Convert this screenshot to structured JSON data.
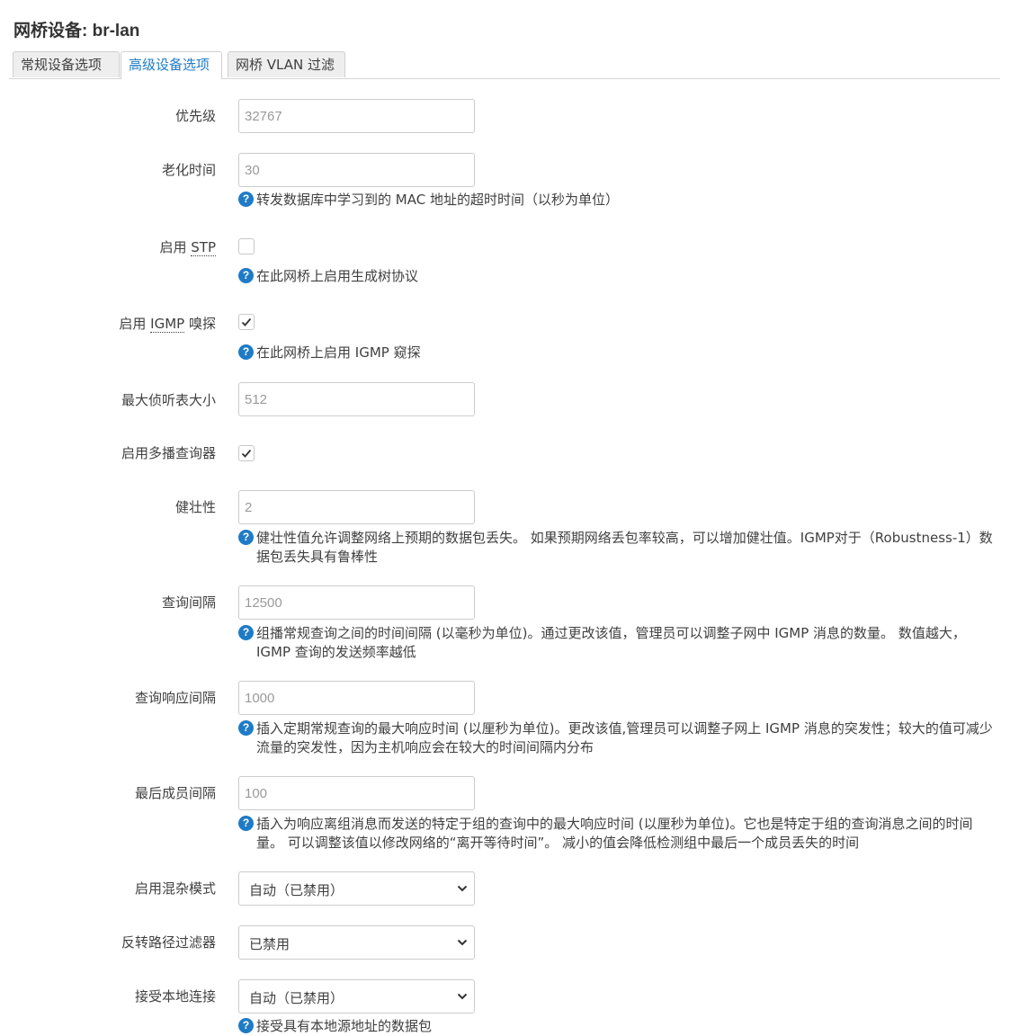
{
  "page": {
    "title": "网桥设备: br-lan"
  },
  "tabs": [
    {
      "label": "常规设备选项"
    },
    {
      "label": "高级设备选项"
    },
    {
      "label": "网桥 VLAN 过滤"
    }
  ],
  "fields": {
    "priority": {
      "label": "优先级",
      "placeholder": "32767"
    },
    "ageing": {
      "label": "老化时间",
      "placeholder": "30",
      "help": "转发数据库中学习到的 MAC 地址的超时时间（以秒为单位）"
    },
    "stp": {
      "label_prefix": "启用 ",
      "label_abbr": "STP",
      "checked": false,
      "help": "在此网桥上启用生成树协议"
    },
    "igmp": {
      "label_prefix": "启用 ",
      "label_abbr": "IGMP",
      "label_suffix": " 嗅探",
      "checked": true,
      "help": "在此网桥上启用 IGMP 窥探"
    },
    "hash_max": {
      "label": "最大侦听表大小",
      "placeholder": "512"
    },
    "querier": {
      "label": "启用多播查询器",
      "checked": true
    },
    "robustness": {
      "label": "健壮性",
      "placeholder": "2",
      "help": "健壮性值允许调整网络上预期的数据包丢失。 如果预期网络丢包率较高，可以增加健壮值。IGMP对于（Robustness-1）数据包丢失具有鲁棒性"
    },
    "query_interval": {
      "label": "查询间隔",
      "placeholder": "12500",
      "help": "组播常规查询之间的时间间隔 (以毫秒为单位)。通过更改该值，管理员可以调整子网中 IGMP 消息的数量。 数值越大，IGMP 查询的发送频率越低"
    },
    "query_response": {
      "label": "查询响应间隔",
      "placeholder": "1000",
      "help": "插入定期常规查询的最大响应时间 (以厘秒为单位)。更改该值,管理员可以调整子网上 IGMP 消息的突发性；较大的值可减少流量的突发性，因为主机响应会在较大的时间间隔内分布"
    },
    "last_member": {
      "label": "最后成员间隔",
      "placeholder": "100",
      "help": "插入为响应离组消息而发送的特定于组的查询中的最大响应时间 (以厘秒为单位)。它也是特定于组的查询消息之间的时间量。 可以调整该值以修改网络的“离开等待时间”。 减小的值会降低检测组中最后一个成员丢失的时间"
    },
    "promisc": {
      "label": "启用混杂模式",
      "value": "自动（已禁用）"
    },
    "rpfilter": {
      "label": "反转路径过滤器",
      "value": "已禁用"
    },
    "acceptlocal": {
      "label": "接受本地连接",
      "value": "自动（已禁用）",
      "help": "接受具有本地源地址的数据包"
    }
  },
  "colors": {
    "accent": "#1f7bc6",
    "text": "#404040"
  },
  "icons": {
    "help": "help-icon",
    "check": "checkmark-icon",
    "dropdown": "chevron-down-icon"
  }
}
